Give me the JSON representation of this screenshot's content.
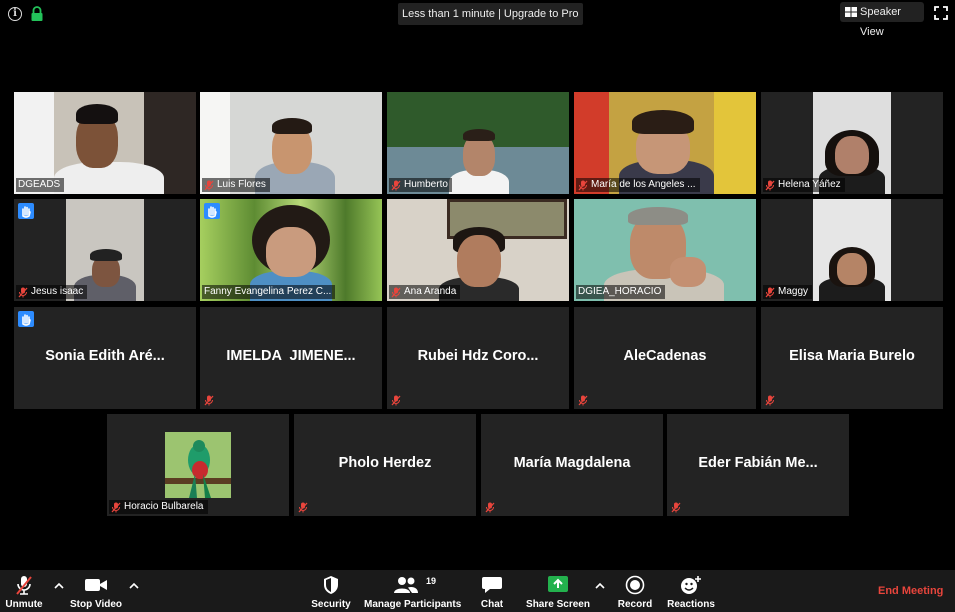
{
  "topbar": {
    "timer_text": "Less than 1 minute | Upgrade to Pro",
    "speaker_view_label": "Speaker View"
  },
  "participants_video": [
    {
      "name": "DGEADS",
      "muted": false
    },
    {
      "name": "Luis Flores",
      "muted": true
    },
    {
      "name": "Humberto",
      "muted": true
    },
    {
      "name": "María de los Angeles ...",
      "muted": true
    },
    {
      "name": "Helena Yáñez",
      "muted": true
    },
    {
      "name": "Jesus isaac",
      "muted": true,
      "hand_raised": true
    },
    {
      "name": "Fanny Evangelina Perez C...",
      "muted": false,
      "hand_raised": true,
      "active_speaker": true
    },
    {
      "name": "Ana Aranda",
      "muted": true
    },
    {
      "name": "DGIEA_HORACIO",
      "muted": false
    },
    {
      "name": "Maggy",
      "muted": true
    }
  ],
  "participants_no_video": [
    {
      "display": "Sonia Edith Aré...",
      "hand_raised": true
    },
    {
      "display": "IMELDA  JIMENE..."
    },
    {
      "display": "Rubei Hdz Coro..."
    },
    {
      "display": "AleCadenas"
    },
    {
      "display": "Elisa Maria Burelo"
    }
  ],
  "participants_row4": [
    {
      "name": "Horacio Bulbarela",
      "type": "photo"
    },
    {
      "display": "Pholo Herdez"
    },
    {
      "display": "María Magdalena"
    },
    {
      "display": "Eder Fabián Me..."
    }
  ],
  "toolbar": {
    "unmute": "Unmute",
    "stop_video": "Stop Video",
    "security": "Security",
    "manage_participants": "Manage Participants",
    "participant_count": "19",
    "chat": "Chat",
    "share_screen": "Share Screen",
    "record": "Record",
    "reactions": "Reactions",
    "end_meeting": "End Meeting"
  },
  "colors": {
    "end_meeting": "#e8453c",
    "share_screen": "#23b14d",
    "raise_hand": "#2d8cff",
    "active_speaker_border": "#d9d96a",
    "mute_icon": "#e8453c"
  }
}
